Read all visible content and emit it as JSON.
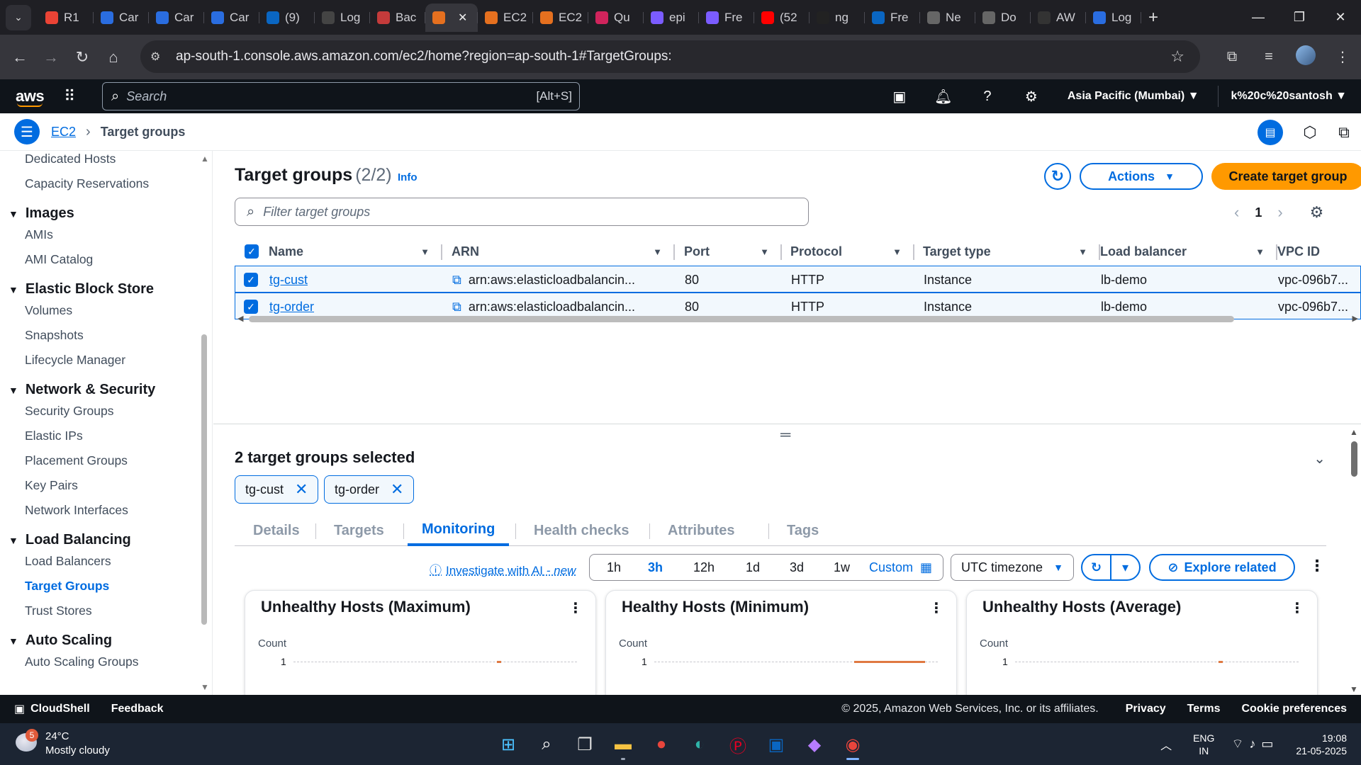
{
  "browser": {
    "tabs": [
      {
        "label": "R1",
        "icon": "gmail-icon",
        "color": "#ea4335"
      },
      {
        "label": "Car",
        "icon": "site-icon",
        "color": "#2a6de0"
      },
      {
        "label": "Car",
        "icon": "site-icon",
        "color": "#2a6de0"
      },
      {
        "label": "Car",
        "icon": "site-icon",
        "color": "#2a6de0"
      },
      {
        "label": "(9)",
        "icon": "linkedin-icon",
        "color": "#0a66c2"
      },
      {
        "label": "Log",
        "icon": "ih-icon",
        "color": "#444"
      },
      {
        "label": "Bac",
        "icon": "t-icon",
        "color": "#c43b3b"
      },
      {
        "label": "",
        "icon": "aws-icon",
        "color": "#e5701f",
        "active": true
      },
      {
        "label": "EC2",
        "icon": "aws-icon",
        "color": "#e5701f"
      },
      {
        "label": "EC2",
        "icon": "aws-icon",
        "color": "#e5701f"
      },
      {
        "label": "Qu",
        "icon": "quiz-icon",
        "color": "#d0245c"
      },
      {
        "label": "epi",
        "icon": "infinity-icon",
        "color": "#7b5cff"
      },
      {
        "label": "Fre",
        "icon": "infinity-icon",
        "color": "#7b5cff"
      },
      {
        "label": "(52",
        "icon": "youtube-icon",
        "color": "#ff0000"
      },
      {
        "label": "ng",
        "icon": "github-icon",
        "color": "#222"
      },
      {
        "label": "Fre",
        "icon": "linkedin-icon",
        "color": "#0a66c2"
      },
      {
        "label": "Ne",
        "icon": "chrome-icon",
        "color": "#666"
      },
      {
        "label": "Do",
        "icon": "download-icon",
        "color": "#666"
      },
      {
        "label": "AW",
        "icon": "aws-icon",
        "color": "#333"
      },
      {
        "label": "Log",
        "icon": "site-icon",
        "color": "#2a6de0"
      }
    ],
    "url": "ap-south-1.console.aws.amazon.com/ec2/home?region=ap-south-1#TargetGroups:"
  },
  "aws_nav": {
    "logo": "aws",
    "search_placeholder": "Search",
    "search_shortcut": "[Alt+S]",
    "region": "Asia Pacific (Mumbai) ▼",
    "user": "k%20c%20santosh ▼"
  },
  "breadcrumb": {
    "root": "EC2",
    "current": "Target groups"
  },
  "sidebar": {
    "items": [
      {
        "type": "item",
        "label": "Dedicated Hosts"
      },
      {
        "type": "item",
        "label": "Capacity Reservations"
      },
      {
        "type": "section",
        "label": "Images"
      },
      {
        "type": "item",
        "label": "AMIs"
      },
      {
        "type": "item",
        "label": "AMI Catalog"
      },
      {
        "type": "section",
        "label": "Elastic Block Store"
      },
      {
        "type": "item",
        "label": "Volumes"
      },
      {
        "type": "item",
        "label": "Snapshots"
      },
      {
        "type": "item",
        "label": "Lifecycle Manager"
      },
      {
        "type": "section",
        "label": "Network & Security"
      },
      {
        "type": "item",
        "label": "Security Groups"
      },
      {
        "type": "item",
        "label": "Elastic IPs"
      },
      {
        "type": "item",
        "label": "Placement Groups"
      },
      {
        "type": "item",
        "label": "Key Pairs"
      },
      {
        "type": "item",
        "label": "Network Interfaces"
      },
      {
        "type": "section",
        "label": "Load Balancing"
      },
      {
        "type": "item",
        "label": "Load Balancers"
      },
      {
        "type": "item",
        "label": "Target Groups",
        "active": true
      },
      {
        "type": "item",
        "label": "Trust Stores"
      },
      {
        "type": "section",
        "label": "Auto Scaling"
      },
      {
        "type": "item",
        "label": "Auto Scaling Groups"
      }
    ]
  },
  "main": {
    "title": "Target groups",
    "count": "(2/2)",
    "info": "Info",
    "actions_label": "Actions",
    "create_label": "Create target group",
    "filter_placeholder": "Filter target groups",
    "page": "1",
    "columns": [
      "Name",
      "ARN",
      "Port",
      "Protocol",
      "Target type",
      "Load balancer",
      "VPC ID"
    ],
    "rows": [
      {
        "name": "tg-cust",
        "arn": "arn:aws:elasticloadbalancin...",
        "port": "80",
        "protocol": "HTTP",
        "target_type": "Instance",
        "load_balancer": "lb-demo",
        "vpc": "vpc-096b7..."
      },
      {
        "name": "tg-order",
        "arn": "arn:aws:elasticloadbalancin...",
        "port": "80",
        "protocol": "HTTP",
        "target_type": "Instance",
        "load_balancer": "lb-demo",
        "vpc": "vpc-096b7..."
      }
    ]
  },
  "split_panel": {
    "title": "2 target groups selected",
    "tokens": [
      "tg-cust",
      "tg-order"
    ],
    "tabs": [
      "Details",
      "Targets",
      "Monitoring",
      "Health checks",
      "Attributes",
      "Tags"
    ],
    "active_tab": "Monitoring",
    "ai_link": "Investigate with AI",
    "ai_new": " - new",
    "time_ranges": [
      "1h",
      "3h",
      "12h",
      "1d",
      "3d",
      "1w"
    ],
    "active_range": "3h",
    "custom_label": "Custom",
    "timezone": "UTC timezone",
    "explore_label": "Explore related",
    "cards": [
      {
        "title": "Unhealthy Hosts (Maximum)",
        "unit": "Count",
        "ytick": "1"
      },
      {
        "title": "Healthy Hosts (Minimum)",
        "unit": "Count",
        "ytick": "1"
      },
      {
        "title": "Unhealthy Hosts (Average)",
        "unit": "Count",
        "ytick": "1"
      }
    ]
  },
  "footer": {
    "cloudshell": "CloudShell",
    "feedback": "Feedback",
    "copyright": "© 2025, Amazon Web Services, Inc. or its affiliates.",
    "privacy": "Privacy",
    "terms": "Terms",
    "cookies": "Cookie preferences"
  },
  "taskbar": {
    "temp": "24°C",
    "weather": "Mostly cloudy",
    "weather_badge": "5",
    "lang1": "ENG",
    "lang2": "IN",
    "time": "19:08",
    "date": "21-05-2025"
  },
  "colors": {
    "aws_dark": "#0f141a",
    "link_blue": "#006ce0",
    "orange": "#ff9900"
  }
}
